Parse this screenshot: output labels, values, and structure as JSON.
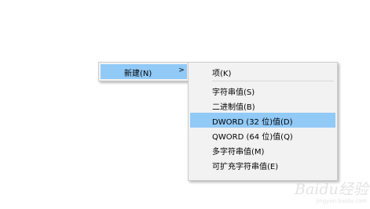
{
  "context_menu": {
    "new_item": {
      "label": "新建(N)",
      "arrow_icon": "chevron-right-icon",
      "arrow_glyph": ">"
    }
  },
  "submenu": {
    "items": [
      {
        "label": "项(K)"
      },
      {
        "label": "字符串值(S)"
      },
      {
        "label": "二进制值(B)"
      },
      {
        "label": "DWORD (32 位)值(D)"
      },
      {
        "label": "QWORD (64 位)值(Q)"
      },
      {
        "label": "多字符串值(M)"
      },
      {
        "label": "可扩充字符串值(E)"
      }
    ],
    "highlight_color": "#91c9f7"
  },
  "watermark": {
    "main": "Baidu经验",
    "sub": "jingyan.baidu.com"
  }
}
